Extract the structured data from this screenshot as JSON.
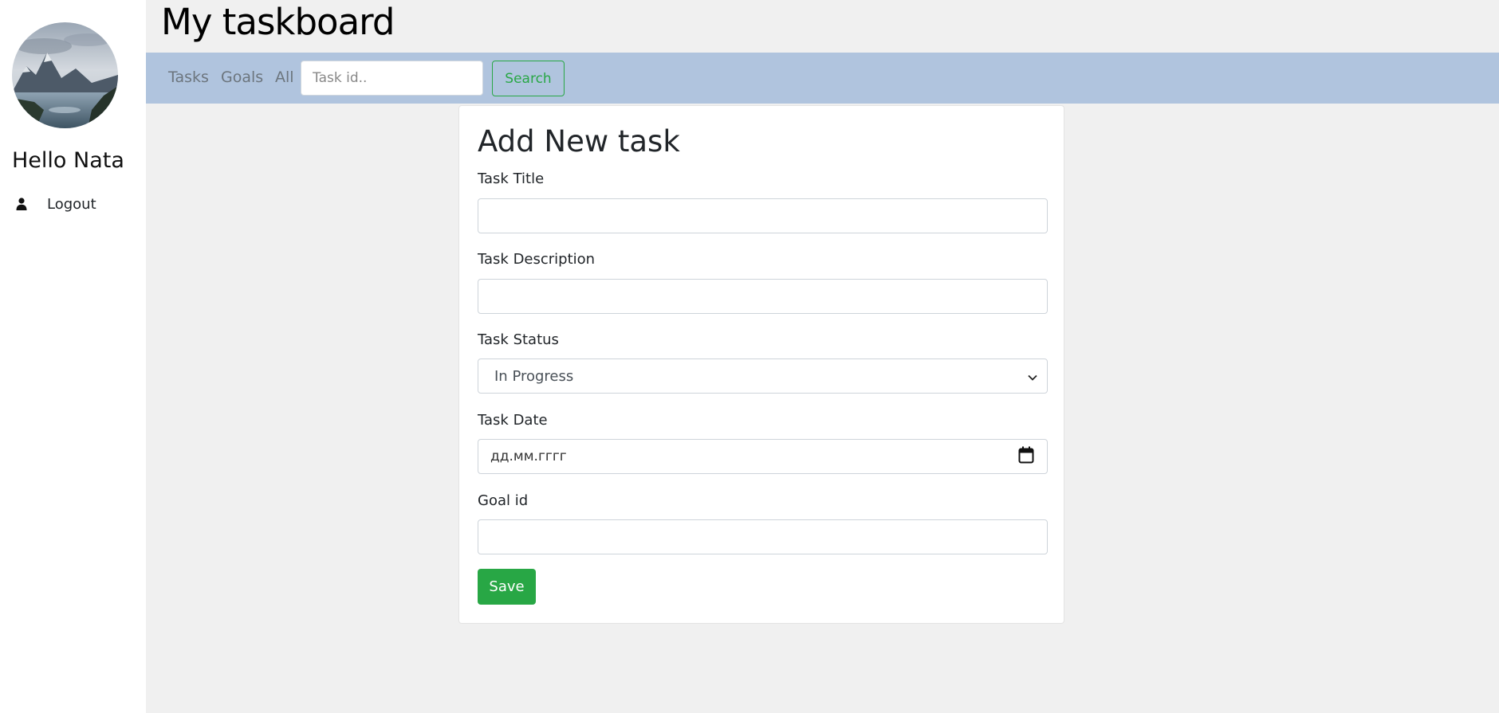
{
  "sidebar": {
    "greeting": "Hello Nata",
    "logout_label": "Logout",
    "user_icon": "user-icon"
  },
  "header": {
    "title": "My taskboard"
  },
  "nav": {
    "links": [
      {
        "label": "Tasks"
      },
      {
        "label": "Goals"
      },
      {
        "label": "All"
      }
    ],
    "search_placeholder": "Task id..",
    "search_value": "",
    "search_button_label": "Search"
  },
  "form": {
    "title": "Add New task",
    "fields": {
      "title": {
        "label": "Task Title",
        "value": ""
      },
      "description": {
        "label": "Task Description",
        "value": ""
      },
      "status": {
        "label": "Task Status",
        "selected": "In Progress"
      },
      "date": {
        "label": "Task Date",
        "placeholder": "дд.мм.гггг"
      },
      "goal_id": {
        "label": "Goal id",
        "value": ""
      }
    },
    "save_label": "Save"
  },
  "colors": {
    "navbar_bg": "#b0c4de",
    "page_bg": "#f0f0f0",
    "success": "#28a745"
  }
}
